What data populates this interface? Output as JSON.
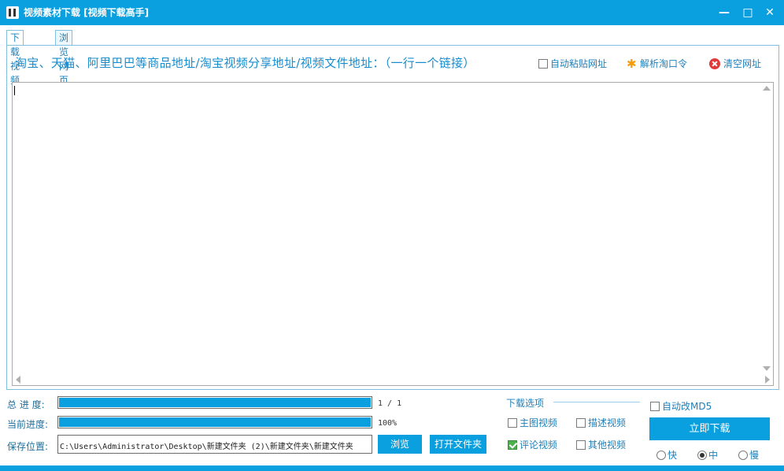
{
  "window": {
    "title": "视频素材下载 [视频下载高手]",
    "min_glyph": "—",
    "max_glyph": "□",
    "close_glyph": "✕"
  },
  "tabs": [
    {
      "label": "下载视频",
      "active": true
    },
    {
      "label": "浏览网页",
      "active": false
    }
  ],
  "header": {
    "instruction": "淘宝、天猫、阿里巴巴等商品地址/淘宝视频分享地址/视频文件地址：（一行一个链接）",
    "auto_paste_label": "自动粘贴网址",
    "auto_paste_checked": false,
    "parse_label": "解析淘口令",
    "clear_label": "清空网址"
  },
  "url_input": {
    "value": ""
  },
  "progress": {
    "total_label": "总 进 度:",
    "total_text": "1 / 1",
    "total_fraction": 1.0,
    "current_label": "当前进度:",
    "current_text": "100%",
    "current_fraction": 1.0
  },
  "save": {
    "label": "保存位置:",
    "path": "C:\\Users\\Administrator\\Desktop\\新建文件夹 (2)\\新建文件夹\\新建文件夹",
    "browse_label": "浏览",
    "open_folder_label": "打开文件夹"
  },
  "download_options": {
    "title": "下载选项",
    "items": [
      {
        "label": "主图视频",
        "checked": false
      },
      {
        "label": "描述视频",
        "checked": false
      },
      {
        "label": "评论视频",
        "checked": true
      },
      {
        "label": "其他视频",
        "checked": false
      }
    ],
    "md5_label": "自动改MD5",
    "md5_checked": false
  },
  "start": {
    "label": "立即下载",
    "speeds": [
      {
        "label": "快",
        "selected": false
      },
      {
        "label": "中",
        "selected": true
      },
      {
        "label": "慢",
        "selected": false
      }
    ]
  },
  "colors": {
    "accent": "#0aa0e0",
    "checked": "#4caf50",
    "danger": "#e23a3a"
  }
}
